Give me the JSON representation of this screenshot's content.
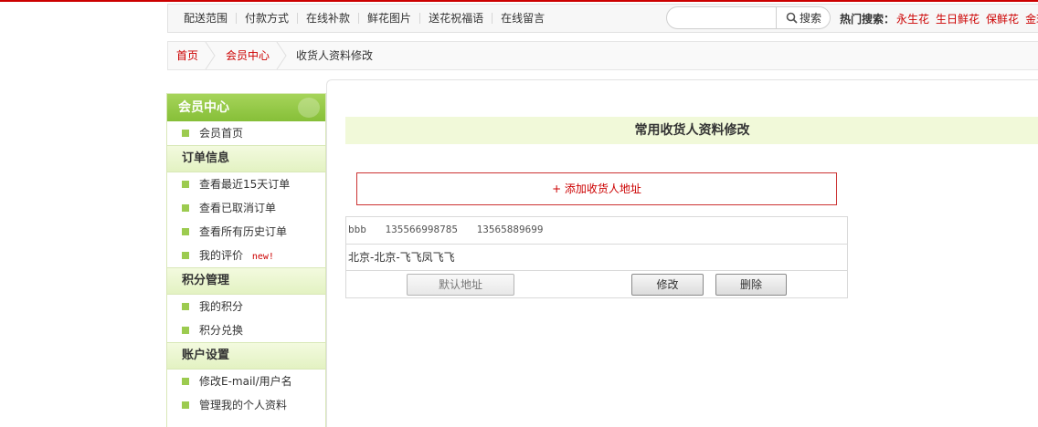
{
  "topnav": {
    "links": [
      "配送范围",
      "付款方式",
      "在线补款",
      "鲜花图片",
      "送花祝福语",
      "在线留言"
    ]
  },
  "search": {
    "placeholder": "",
    "button_label": "搜索",
    "icon": "search-icon"
  },
  "hot_search": {
    "label": "热门搜索：",
    "links": [
      "永生花",
      "生日鲜花",
      "保鲜花",
      "金玫"
    ]
  },
  "breadcrumb": {
    "items": [
      "首页",
      "会员中心",
      "收货人资料修改"
    ]
  },
  "sidebar": {
    "title": "会员中心",
    "top_item": "会员首页",
    "sections": [
      {
        "title": "订单信息",
        "items": [
          "查看最近15天订单",
          "查看已取消订单",
          "查看所有历史订单",
          "我的评价"
        ]
      },
      {
        "title": "积分管理",
        "items": [
          "我的积分",
          "积分兑换"
        ]
      },
      {
        "title": "账户设置",
        "items": [
          "修改E-mail/用户名",
          "管理我的个人资料"
        ]
      }
    ],
    "new_badge": "new!"
  },
  "main": {
    "title": "常用收货人资料修改",
    "add_label": "+ 添加收货人地址",
    "address": {
      "name": "bbb",
      "phone1": "135566998785",
      "phone2": "13565889699",
      "detail": "北京-北京-飞飞凤飞飞"
    },
    "buttons": {
      "default": "默认地址",
      "edit": "修改",
      "delete": "删除"
    }
  },
  "colors": {
    "accent_red": "#cc0000",
    "sidebar_green": "#86bf38",
    "title_bar_bg": "#f1f9d9"
  }
}
